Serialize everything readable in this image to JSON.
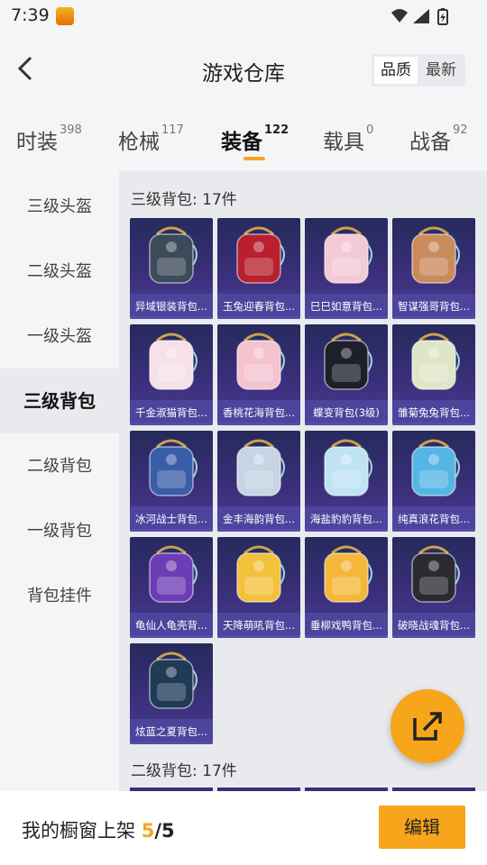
{
  "status": {
    "time": "7:39"
  },
  "header": {
    "title": "游戏仓库",
    "sort_options": [
      "品质",
      "最新"
    ]
  },
  "tabs": [
    {
      "label": "时装",
      "count": "398"
    },
    {
      "label": "枪械",
      "count": "117"
    },
    {
      "label": "装备",
      "count": "122"
    },
    {
      "label": "载具",
      "count": "0"
    },
    {
      "label": "战备",
      "count": "92"
    }
  ],
  "sidebar": {
    "items": [
      "三级头盔",
      "二级头盔",
      "一级头盔",
      "三级背包",
      "二级背包",
      "一级背包",
      "背包挂件"
    ]
  },
  "sections": [
    {
      "title": "三级背包: 17件"
    },
    {
      "title": "二级背包: 17件"
    }
  ],
  "items": [
    {
      "label": "异域银装背包...",
      "icon": "backpack-icon",
      "color": "#3d4a5a"
    },
    {
      "label": "玉兔迎春背包...",
      "icon": "backpack-icon",
      "color": "#b8202e"
    },
    {
      "label": "巳巳如意背包...",
      "icon": "backpack-icon",
      "color": "#f3c9d6"
    },
    {
      "label": "智谋强哥背包...",
      "icon": "backpack-icon",
      "color": "#c98a5c"
    },
    {
      "label": "千金淑猫背包...",
      "icon": "backpack-icon",
      "color": "#f6e1e8"
    },
    {
      "label": "香桃花海背包...",
      "icon": "backpack-icon",
      "color": "#f5c2d0"
    },
    {
      "label": "蝶变背包(3级)",
      "icon": "backpack-icon",
      "color": "#1d2028"
    },
    {
      "label": "雏菊兔兔背包...",
      "icon": "backpack-icon",
      "color": "#dfe6c8"
    },
    {
      "label": "冰河战士背包...",
      "icon": "backpack-icon",
      "color": "#3a5da8"
    },
    {
      "label": "金丰海韵背包...",
      "icon": "backpack-icon",
      "color": "#c7d4e4"
    },
    {
      "label": "海盐豹豹背包...",
      "icon": "backpack-icon",
      "color": "#bfe3f2"
    },
    {
      "label": "纯真浪花背包...",
      "icon": "backpack-icon",
      "color": "#55b6e6"
    },
    {
      "label": "龟仙人龟壳背...",
      "icon": "backpack-icon",
      "color": "#6c3db5"
    },
    {
      "label": "天降萌吼背包...",
      "icon": "backpack-icon",
      "color": "#f2c23c"
    },
    {
      "label": "垂柳戏鸭背包...",
      "icon": "backpack-icon",
      "color": "#f5b73a"
    },
    {
      "label": "破晓战魂背包...",
      "icon": "backpack-icon",
      "color": "#2a2a30"
    },
    {
      "label": "炫蓝之夏背包...",
      "icon": "backpack-icon",
      "color": "#1f3b55"
    }
  ],
  "bottom": {
    "prefix": "我的橱窗上架 ",
    "count": "5",
    "total": "/5",
    "edit_label": "编辑"
  },
  "colors": {
    "accent": "#f7a51b",
    "card_bg": "#3a2f79"
  }
}
